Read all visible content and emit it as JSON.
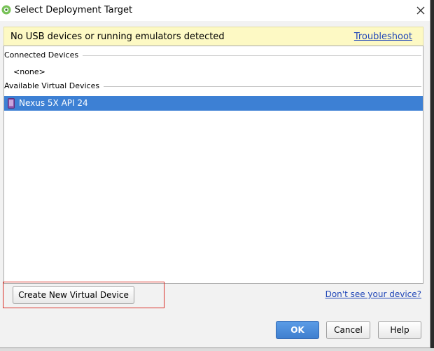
{
  "window": {
    "title": "Select Deployment Target"
  },
  "banner": {
    "message": "No USB devices or running emulators detected",
    "link": "Troubleshoot"
  },
  "device_list": {
    "connected_header": "Connected Devices",
    "connected_empty": "<none>",
    "available_header": "Available Virtual Devices",
    "devices": [
      {
        "name": "Nexus 5X API 24",
        "selected": true
      }
    ]
  },
  "actions": {
    "create_button": "Create New Virtual Device",
    "dont_see_link": "Don't see your device?",
    "ok_button": "OK",
    "cancel_button": "Cancel",
    "help_button": "Help"
  },
  "colors": {
    "banner_bg": "#fdf9c4",
    "selection": "#3d80d4",
    "link": "#2147b8",
    "highlight_outline": "#d9322a"
  },
  "icons": {
    "app": "android-studio-icon",
    "close": "close-icon",
    "device": "phone-icon"
  }
}
